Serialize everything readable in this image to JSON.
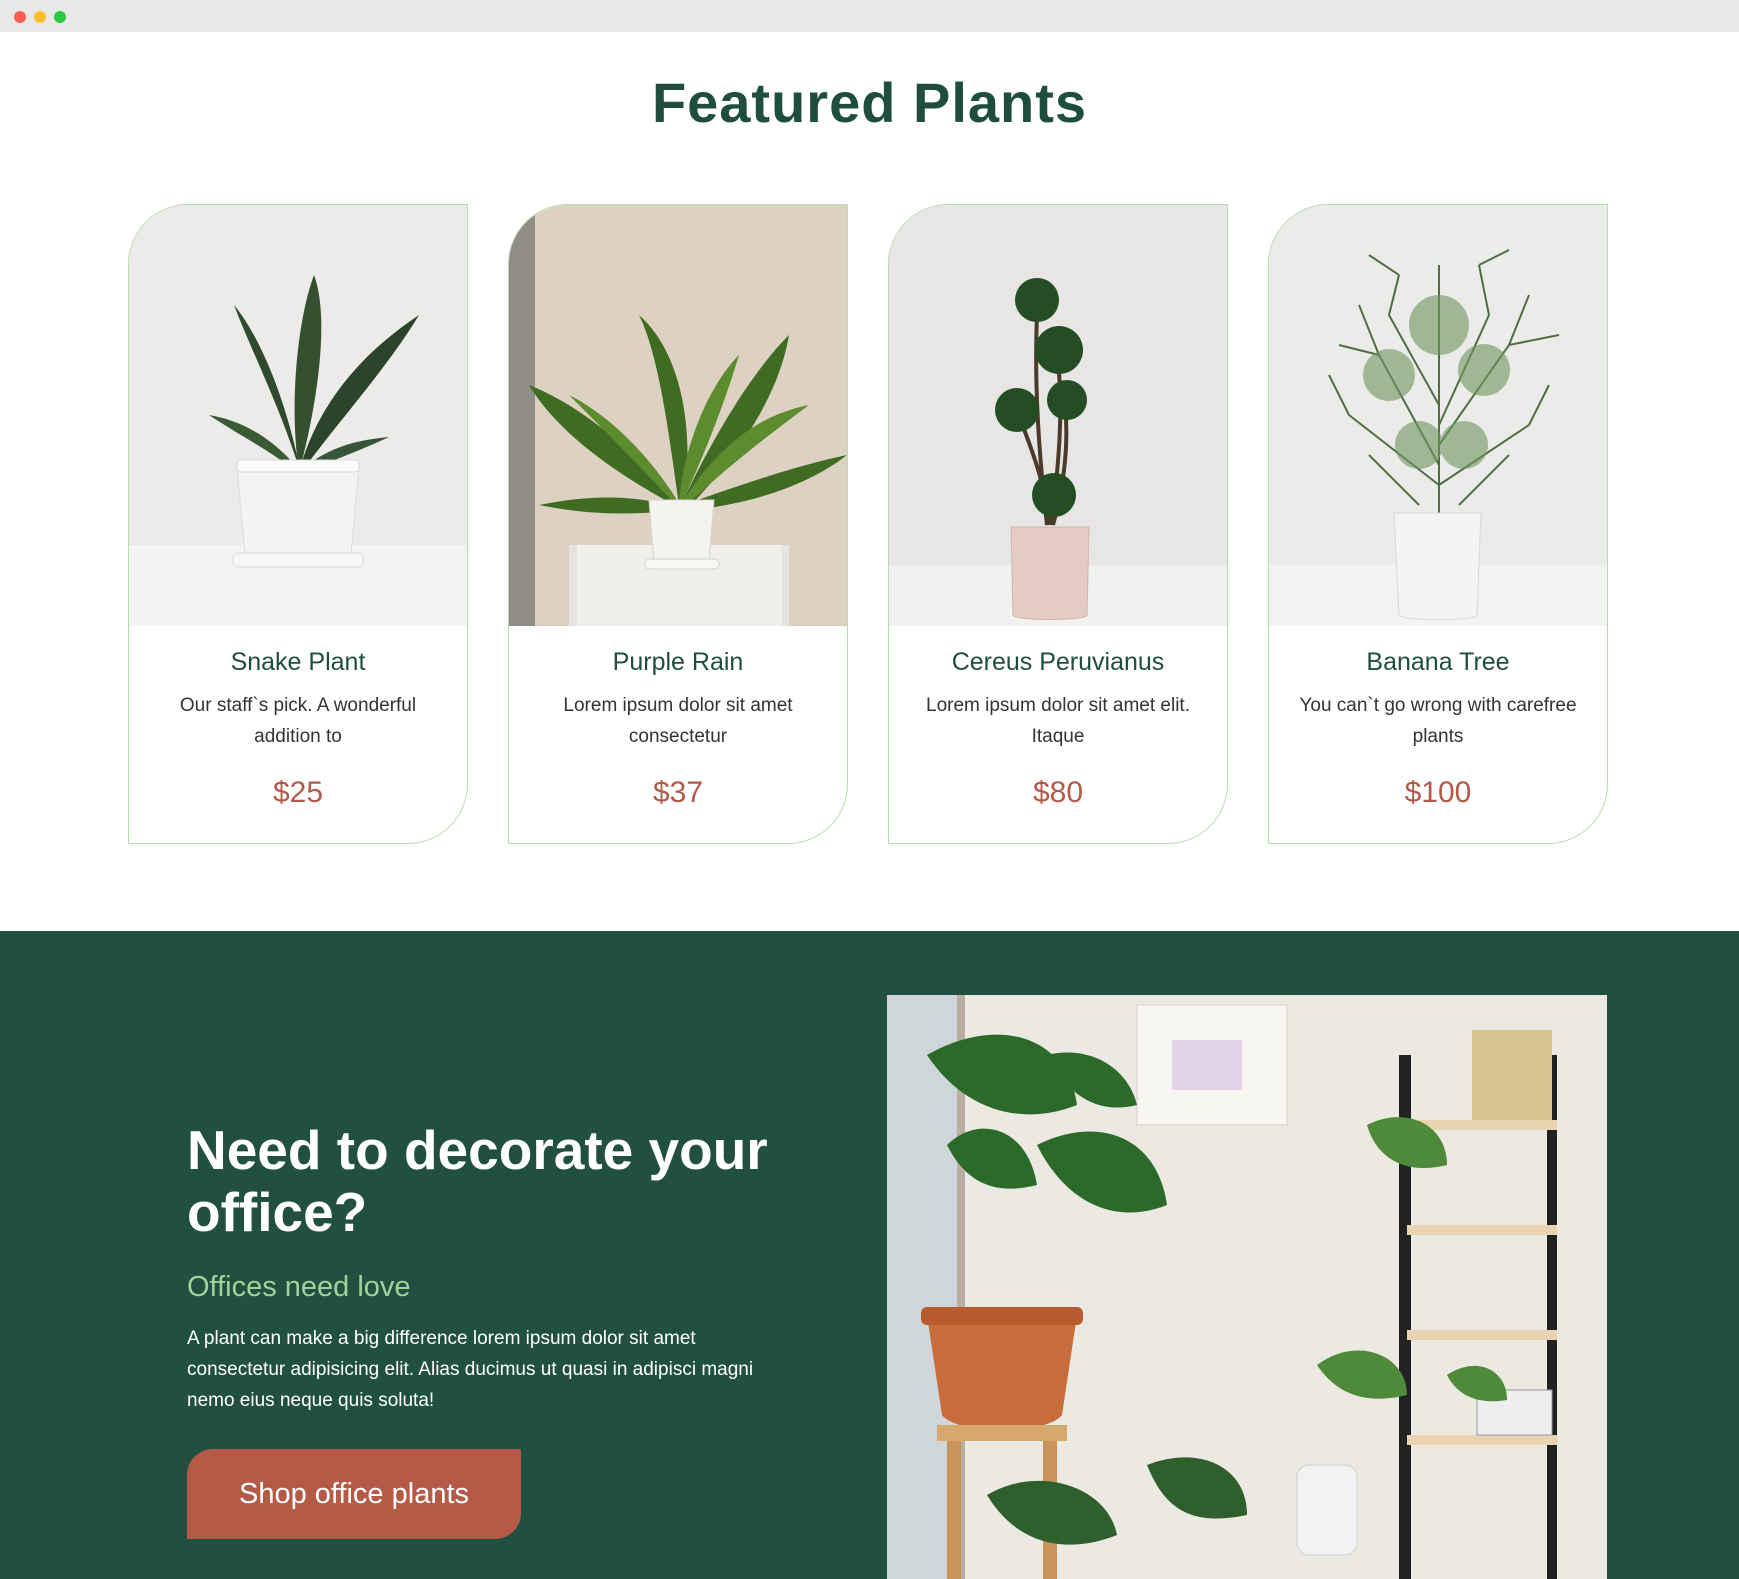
{
  "featured": {
    "title": "Featured Plants",
    "cards": [
      {
        "name": "Snake Plant",
        "description": "Our staff`s pick. A wonderful addition to",
        "price": "$25"
      },
      {
        "name": "Purple Rain",
        "description": "Lorem ipsum dolor sit amet consectetur",
        "price": "$37"
      },
      {
        "name": "Cereus Peruvianus",
        "description": "Lorem ipsum dolor sit amet elit. Itaque",
        "price": "$80"
      },
      {
        "name": "Banana Tree",
        "description": "You can`t go wrong with carefree plants",
        "price": "$100"
      }
    ]
  },
  "office": {
    "title": "Need to decorate your office?",
    "subtitle": "Offices need love",
    "text": "A plant can make a big difference lorem ipsum dolor sit amet consectetur adipisicing elit. Alias ducimus ut quasi in adipisci magni nemo eius neque quis soluta!",
    "button_label": "Shop office plants"
  },
  "colors": {
    "heading_green": "#1f4e3d",
    "section_bg": "#214f40",
    "price": "#b2594a",
    "button": "#b65a48",
    "accent_light_green": "#9fd39a",
    "card_border": "#b9dbb0"
  }
}
